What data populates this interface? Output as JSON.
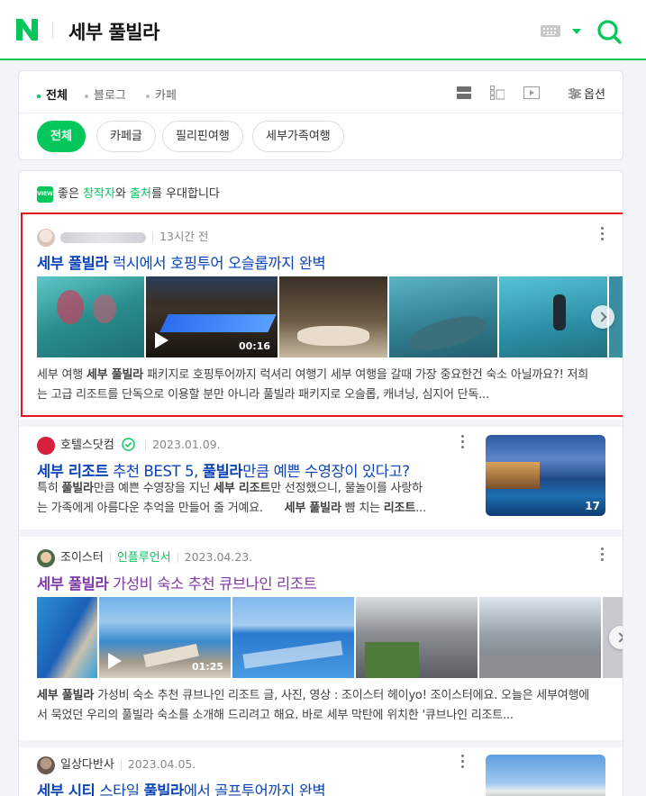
{
  "header": {
    "logo": "N",
    "query": "세부 풀빌라",
    "keyboard_icon": "keyboard-icon",
    "search_icon": "search-icon",
    "brand_color": "#03c75a"
  },
  "filters": {
    "tabs": [
      "전체",
      "블로그",
      "카페"
    ],
    "options_label": "옵션",
    "chips": [
      "전체",
      "카페글",
      "필리핀여행",
      "세부가족여행"
    ]
  },
  "notice": {
    "pre": "좋은 ",
    "creator": "창작자",
    "mid": "와 ",
    "attend": "출처",
    "post": "를 우대합니다",
    "badge": "VIEW"
  },
  "results": [
    {
      "author": "",
      "time": "13시간 전",
      "title_bold": "세부 풀빌라",
      "title_rest": " 럭시에서 호핑투어 오슬롭까지 완벽",
      "video_duration": "00:16",
      "desc_pre": "세부 여행 ",
      "desc_bold": "세부 풀빌라",
      "desc_post": " 패키지로 호핑투어까지 럭셔리 여행기 세부 여행을 갈때 가장 중요한건 숙소 아닐까요?! 저희는 고급 리조트를 단독으로 이용할 분만 아니라 풀빌라 패키지로 오슬롭, 캐녀닝, 심지어 단독..."
    },
    {
      "author": "호텔스닷컴",
      "date": "2023.01.09.",
      "title_a": "세부 리조트",
      "title_b": " 추천 BEST 5, ",
      "title_c": "풀빌라",
      "title_d": "만큼 예쁜 수영장이 있다고?",
      "desc_1a": "특히 ",
      "desc_1b": "풀빌라",
      "desc_1c": "만큼 예쁜 수영장을 지닌 ",
      "desc_1d": "세부 리조트",
      "desc_1e": "만 선정했으니, 물놀이를 사랑하",
      "desc_2a": "는 가족에게 아름다운 추억을 만들어 줄 거예요.",
      "desc_2b": "세부 풀빌라",
      "desc_2c": " 뺨 치는 ",
      "desc_2d": "리조트",
      "desc_2e": "...",
      "image_count": "17"
    },
    {
      "author": "조이스터",
      "badge": "인플루언서",
      "date": "2023.04.23.",
      "title_bold": "세부 풀빌라",
      "title_rest": " 가성비 숙소 추천 큐브나인 리조트",
      "video_duration": "01:25",
      "desc_bold": "세부 풀빌라",
      "desc_post": " 가성비 숙소 추천 큐브나인 리조트 글, 사진, 영상 : 조이스터 헤이yo! 조이스터에요. 오늘은 세부여행에서 묵었던 우리의 풀빌라 숙소를 소개해 드리려고 해요. 바로 세부 막탄에 위치한 '큐브나인 리조트..."
    },
    {
      "author": "일상다반사",
      "date": "2023.04.05.",
      "title_a": "세부 시티",
      "title_b": " 스타일 ",
      "title_c": "풀빌라",
      "title_d": "에서 골프투어까지 완벽"
    }
  ]
}
